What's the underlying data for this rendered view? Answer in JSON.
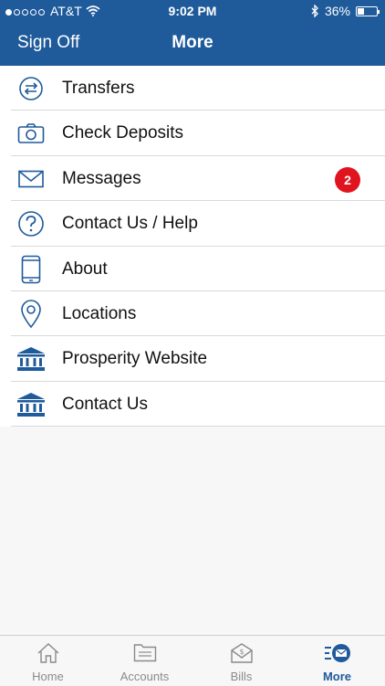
{
  "status": {
    "carrier": "AT&T",
    "time": "9:02 PM",
    "battery": "36%",
    "battery_level": 0.36
  },
  "nav": {
    "back_label": "Sign Off",
    "title": "More"
  },
  "menu": [
    {
      "label": "Transfers",
      "icon": "transfer-icon"
    },
    {
      "label": "Check Deposits",
      "icon": "camera-icon"
    },
    {
      "label": "Messages",
      "icon": "envelope-icon",
      "badge": "2"
    },
    {
      "label": "Contact Us / Help",
      "icon": "help-icon"
    },
    {
      "label": "About",
      "icon": "phone-icon"
    },
    {
      "label": "Locations",
      "icon": "location-pin-icon"
    },
    {
      "label": "Prosperity Website",
      "icon": "bank-icon"
    },
    {
      "label": "Contact Us",
      "icon": "bank-icon"
    }
  ],
  "tabs": [
    {
      "label": "Home",
      "icon": "home-icon"
    },
    {
      "label": "Accounts",
      "icon": "accounts-icon"
    },
    {
      "label": "Bills",
      "icon": "bills-icon"
    },
    {
      "label": "More",
      "icon": "more-icon",
      "active": true
    }
  ],
  "colors": {
    "brand": "#1f5a9b",
    "badge": "#e0141e"
  }
}
